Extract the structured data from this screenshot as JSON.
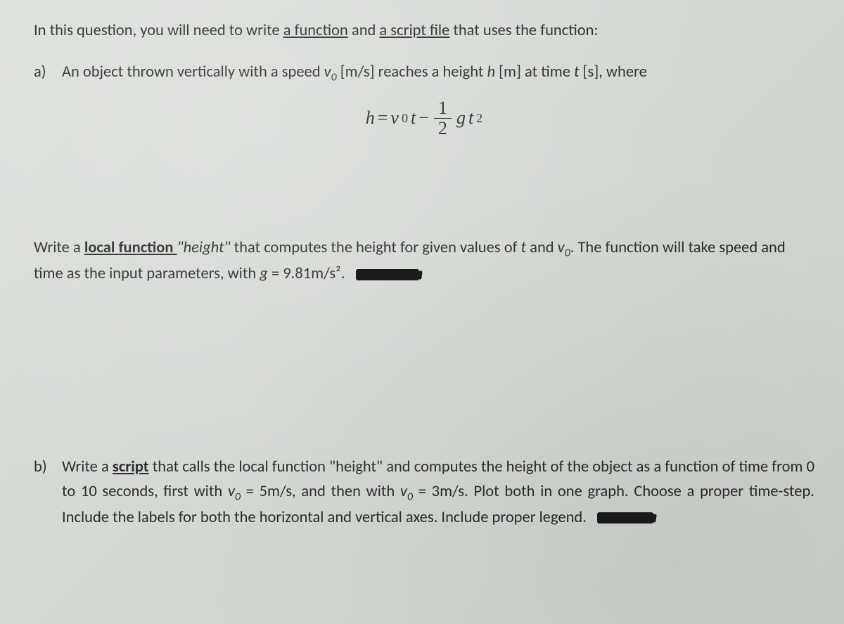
{
  "intro": {
    "prefix": "In this question, you will need to write ",
    "link1": "a function",
    "mid1": " and ",
    "link2": "a script file",
    "suffix": " that uses the function:"
  },
  "partA": {
    "label": "a)",
    "text_before_v0": "An object thrown vertically with a speed ",
    "v0_var": "v",
    "v0_sub": "0",
    "text_mid1": " [m/s] reaches a height ",
    "h_var": "h",
    "text_mid2": " [m] at time ",
    "t_var": "t",
    "text_after": " [s], where"
  },
  "equation": {
    "h": "h",
    "eq": " = ",
    "v": "v",
    "sub0": "0",
    "t": "t",
    "minus": " − ",
    "frac_num": "1",
    "frac_den": "2",
    "g": "g",
    "t2": "t",
    "sq": "2"
  },
  "midPara": {
    "p1": "Write a ",
    "local_fn": "local function ",
    "height_q1": "\"",
    "height_word": "height",
    "height_q2": "\"",
    "p2": " that computes the height for given values of ",
    "t_var": "t",
    "p3": " and ",
    "v0_v": "v",
    "v0_s": "0",
    "p4": ".  The function will take speed and time as the input parameters, with ",
    "g_var": "g",
    "p5": " = 9.81m/s².   "
  },
  "partB": {
    "label": "b)",
    "s1": "Write a ",
    "script_u": "script",
    "s2": " that calls the local function \"height\" and computes the height of the object as a function of time from 0 to 10 seconds, first with ",
    "v1v": "v",
    "v1s": "0",
    "s3": " = 5m/s, and then with ",
    "v2v": "v",
    "v2s": "0",
    "s4": " = 3m/s. Plot both in one graph.  Choose a proper time-step. Include the labels for both the horizontal and vertical axes. Include proper legend."
  }
}
